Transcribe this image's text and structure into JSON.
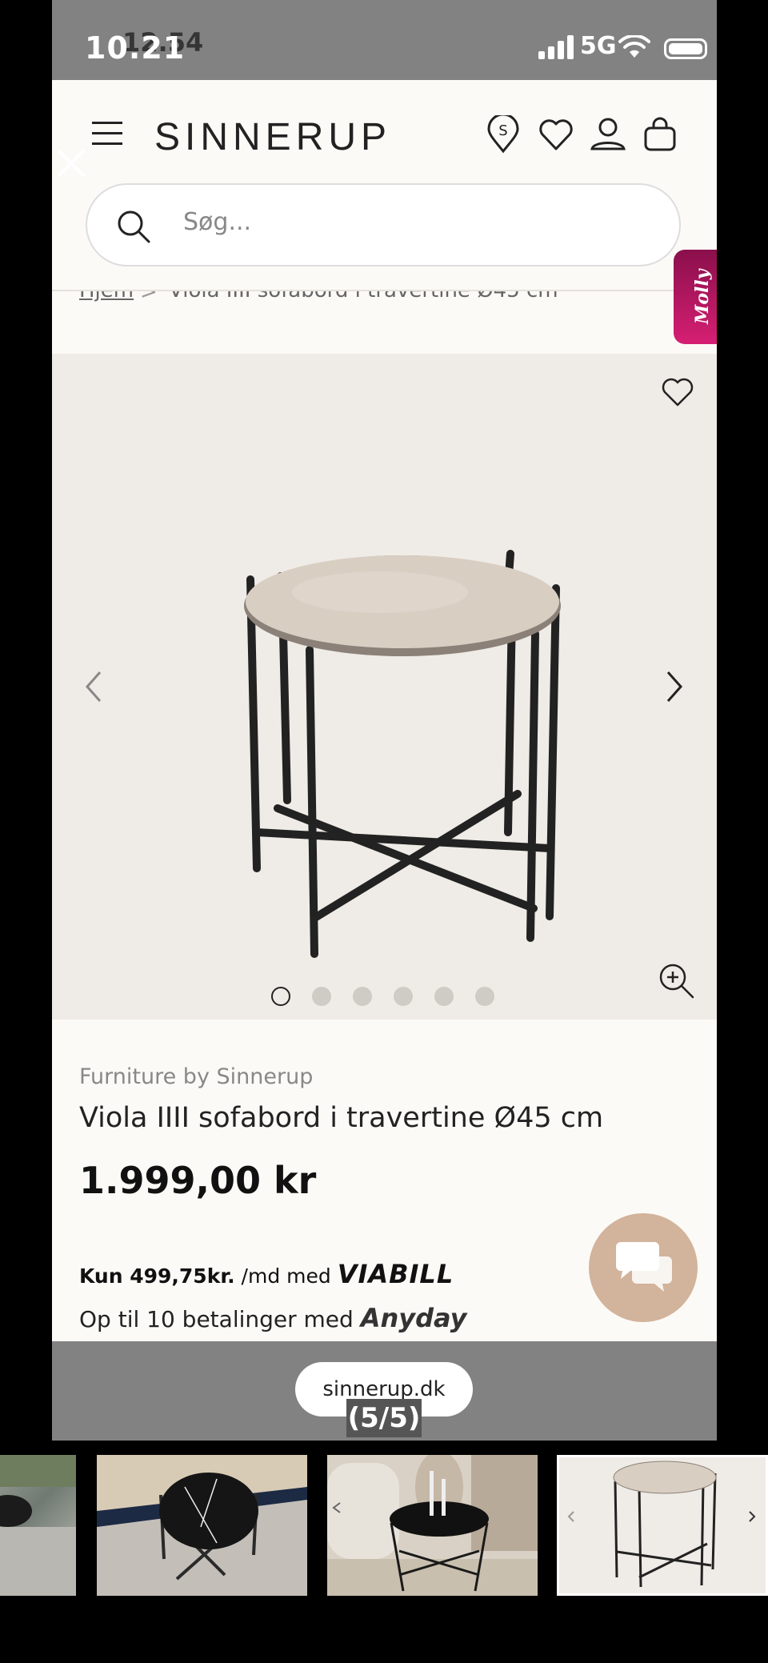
{
  "status_bar": {
    "time": "10.21",
    "time_overlay": "12.54",
    "carrier": "5G"
  },
  "header": {
    "logo": "SINNERUP"
  },
  "search": {
    "placeholder": "Søg..."
  },
  "breadcrumb": {
    "home": "Hjem",
    "separator": ">",
    "current": "Viola IIII sofabord i travertine Ø45 cm"
  },
  "molly": {
    "label": "Molly"
  },
  "gallery": {
    "dot_count": 6,
    "active_dot": 0
  },
  "product": {
    "brand": "Furniture by Sinnerup",
    "title": "Viola IIII sofabord i travertine Ø45 cm",
    "price": "1.999,00 kr",
    "viabill_prefix": "Kun 499,75kr.",
    "viabill_mid": " /md med ",
    "viabill_logo": "VIABILL",
    "anyday_text": "Op til 10 betalinger med ",
    "anyday_logo": "Anyday"
  },
  "browser": {
    "url": "sinnerup.dk"
  },
  "viewer": {
    "counter": "(5/5)"
  },
  "colors": {
    "accent_molly": "#c2185b",
    "chat_button": "#d2b39b",
    "page_bg": "#fcfaf6",
    "gallery_bg": "#efebe6"
  }
}
